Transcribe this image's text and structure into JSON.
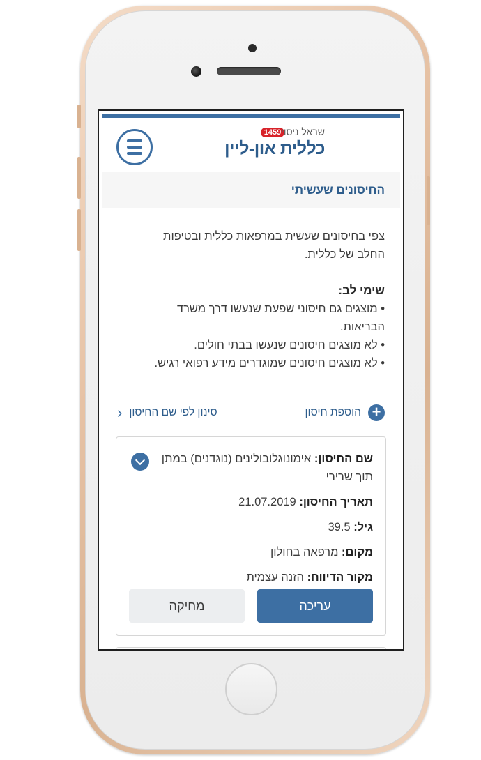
{
  "header": {
    "user_name": "שראל ניסוי",
    "notification_count": "1459",
    "brand": "כללית און-ליין"
  },
  "section": {
    "title": "החיסונים שעשיתי"
  },
  "intro": {
    "line1": "צפי בחיסונים שעשית במרפאות כללית ובטיפות",
    "line2": "החלב של כללית."
  },
  "notice": {
    "title": "שימי לב:",
    "items": [
      "מוצגים גם חיסוני שפעת שנעשו דרך משרד",
      "הבריאות.",
      "לא מוצגים חיסונים שנעשו בבתי חולים.",
      "לא מוצגים חיסונים שמוגדרים מידע רפואי רגיש."
    ]
  },
  "actions": {
    "add_label": "הוספת חיסון",
    "filter_label": "סינון לפי שם החיסון"
  },
  "card": {
    "name_label": "שם החיסון:",
    "name_value": "אימונוגלובולינים (נוגדנים) במתן תוך שרירי",
    "date_label": "תאריך החיסון:",
    "date_value": "21.07.2019",
    "age_label": "גיל:",
    "age_value": "39.5",
    "place_label": "מקום:",
    "place_value": "מרפאה בחולון",
    "source_label": "מקור הדיווח:",
    "source_value": "הזנה עצמית",
    "edit_label": "עריכה",
    "delete_label": "מחיקה"
  },
  "icons": {
    "menu": "hamburger-menu-icon",
    "add": "plus-circle-icon",
    "filter": "chevron-left-icon",
    "expand": "chevron-down-icon"
  },
  "colors": {
    "brand_blue": "#3d6fa3",
    "title_blue": "#2e5d8c",
    "badge_red": "#d8232a"
  }
}
